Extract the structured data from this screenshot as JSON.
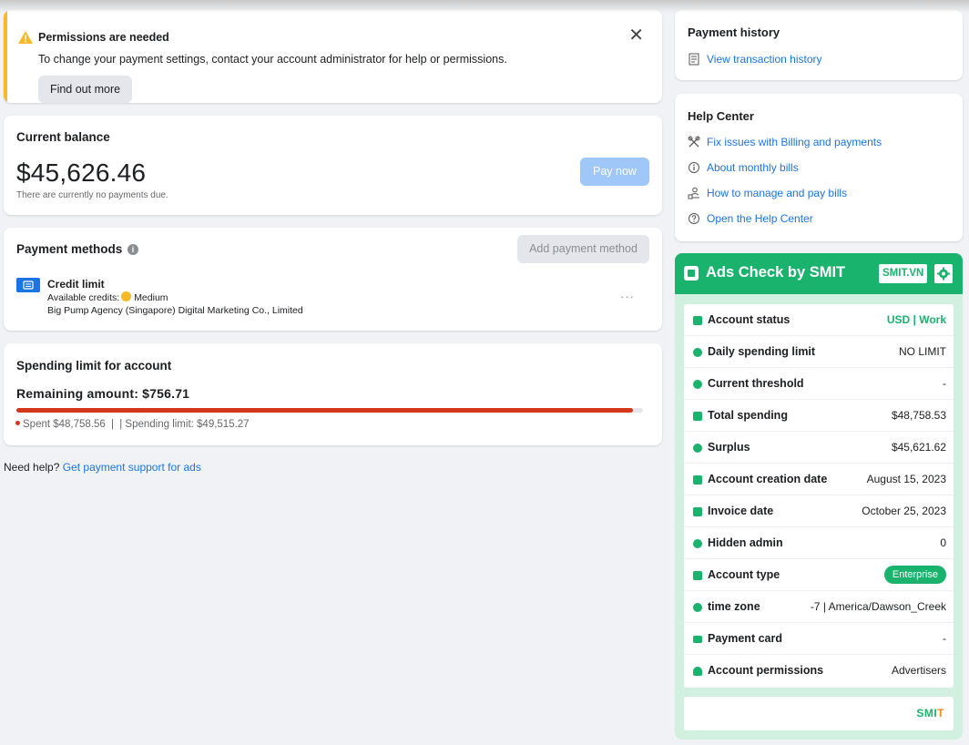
{
  "alert": {
    "title": "Permissions are needed",
    "description": "To change your payment settings, contact your account administrator for help or permissions.",
    "button": "Find out more",
    "close": "✕"
  },
  "balance": {
    "title": "Current balance",
    "amount": "$45,626.46",
    "note": "There are currently no payments due.",
    "pay_button": "Pay now"
  },
  "methods": {
    "title": "Payment methods",
    "info": "i",
    "add_button": "Add payment method",
    "item": {
      "name": "Credit limit",
      "available_label": "Available credits:",
      "available_value": "Medium",
      "company": "Big Pump Agency (Singapore) Digital Marketing Co., Limited",
      "more": "···"
    }
  },
  "limit": {
    "title": "Spending limit for account",
    "remaining": "Remaining amount: $756.71",
    "spent": "Spent $48,758.56",
    "separator": "|",
    "limit_text": "| Spending limit: $49,515.27",
    "spent_fraction": 0.9847
  },
  "help": {
    "prefix": "Need help?",
    "link": "Get payment support for ads"
  },
  "history": {
    "title": "Payment history",
    "link": "View transaction history"
  },
  "helpcenter": {
    "title": "Help Center",
    "links": [
      {
        "label": "Fix issues with Billing and payments",
        "icon": "tools-icon"
      },
      {
        "label": "About monthly bills",
        "icon": "info-icon"
      },
      {
        "label": "How to manage and pay bills",
        "icon": "payer-icon"
      },
      {
        "label": "Open the Help Center",
        "icon": "question-icon"
      }
    ]
  },
  "smit": {
    "title": "Ads Check by SMIT",
    "tag": "SMIT.VN",
    "rows": [
      {
        "label": "Account status",
        "value": "USD | Work"
      },
      {
        "label": "Daily spending limit",
        "value": "NO LIMIT"
      },
      {
        "label": "Current threshold",
        "value": "-"
      },
      {
        "label": "Total spending",
        "value": "$48,758.53"
      },
      {
        "label": "Surplus",
        "value": "$45,621.62"
      },
      {
        "label": "Account creation date",
        "value": "August 15, 2023"
      },
      {
        "label": "Invoice date",
        "value": "October 25, 2023"
      },
      {
        "label": "Hidden admin",
        "value": "0"
      },
      {
        "label": "Account type",
        "value": "Enterprise"
      },
      {
        "label": "time zone",
        "value": "-7 | America/Dawson_Creek"
      },
      {
        "label": "Payment card",
        "value": "-"
      },
      {
        "label": "Account permissions",
        "value": "Advertisers"
      }
    ],
    "footer_brand_a": "SMI",
    "footer_brand_b": "T"
  },
  "colors": {
    "accent": "#1b74e4",
    "warning": "#f7b928",
    "spent": "#d4371c",
    "smit_green": "#1ab36e"
  }
}
